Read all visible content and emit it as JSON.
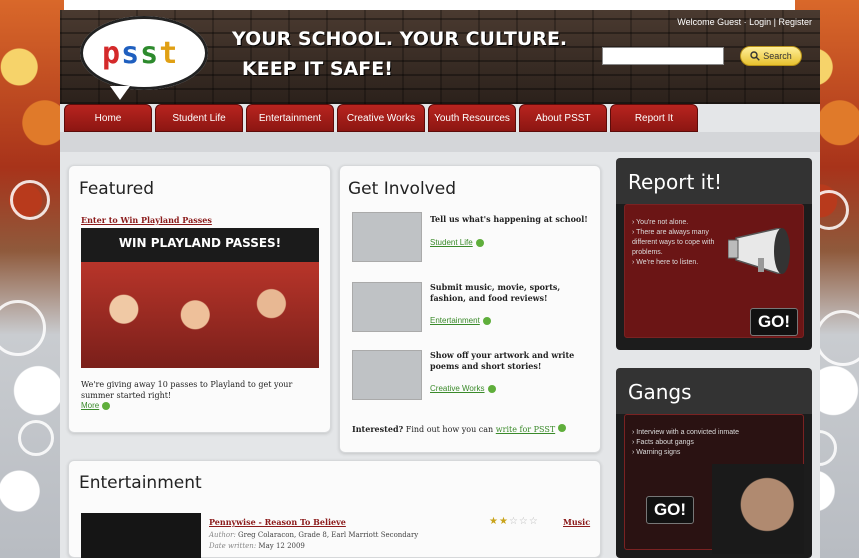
{
  "header": {
    "logo_text": "psst",
    "tagline_1": "YOUR SCHOOL. YOUR CULTURE.",
    "tagline_2": "KEEP IT SAFE!",
    "welcome": "Welcome Guest",
    "login": "Login",
    "register": "Register",
    "search_placeholder": "",
    "search_button": "Search"
  },
  "nav": {
    "items": [
      {
        "label": "Home"
      },
      {
        "label": "Student Life"
      },
      {
        "label": "Entertainment"
      },
      {
        "label": "Creative Works"
      },
      {
        "label": "Youth Resources"
      },
      {
        "label": "About PSST"
      },
      {
        "label": "Report It"
      }
    ]
  },
  "featured": {
    "title": "Featured",
    "link": "Enter to Win Playland Passes",
    "banner": "WIN PLAYLAND PASSES!",
    "text": "We're giving away 10 passes to Playland to get your summer started right!",
    "more": "More"
  },
  "involved": {
    "title": "Get Involved",
    "items": [
      {
        "heading": "Tell us what's happening at school!",
        "link": "Student Life"
      },
      {
        "heading": "Submit music, movie, sports, fashion, and food reviews!",
        "link": "Entertainment"
      },
      {
        "heading": "Show off your artwork and write poems and short stories!",
        "link": "Creative Works"
      }
    ],
    "footer_bold": "Interested?",
    "footer_text": "Find out how you can",
    "footer_link": "write for PSST"
  },
  "report": {
    "title": "Report it!",
    "items": [
      "You're not alone.",
      "There are always many different ways to cope with problems.",
      "We're here to listen."
    ],
    "go": "GO!"
  },
  "gangs": {
    "title": "Gangs",
    "items": [
      "Interview with a convicted inmate",
      "Facts about gangs",
      "Warning signs"
    ],
    "go": "GO!"
  },
  "entertainment": {
    "title": "Entertainment",
    "item_title": "Pennywise - Reason To Believe",
    "author_label": "Author:",
    "author": "Greg Colaracon, Grade 8, Earl Marriott Secondary",
    "date_label": "Date written:",
    "date": "May 12 2009",
    "category": "Music",
    "rating": 2,
    "rating_max": 5
  }
}
